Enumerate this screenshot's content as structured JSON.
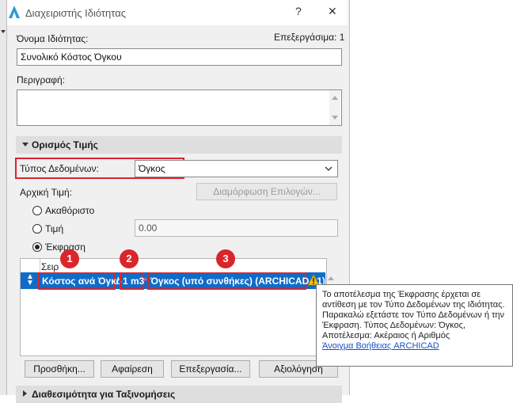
{
  "window": {
    "title": "Διαχειριστής Ιδιότητας",
    "help_glyph": "?",
    "close_glyph": "✕"
  },
  "header": {
    "name_label": "Όνομα Ιδιότητας:",
    "edit_count": "Επεξεργάσιμα: 1",
    "name_value": "Συνολικό Κόστος Όγκου",
    "description_label": "Περιγραφή:"
  },
  "value_definition": {
    "section_title": "Ορισμός Τιμής",
    "data_type_label": "Τύπος Δεδομένων:",
    "data_type_value": "Όγκος",
    "initial_value_label": "Αρχική Τιμή:",
    "options_button": "Διαμόρφωση Επιλογών...",
    "radio_undefined": "Ακαθόριστο",
    "radio_value": "Τιμή",
    "value_field": "0.00",
    "radio_expression": "Έκφραση",
    "column_header": "Σειρ",
    "expression": {
      "part1": "Κόστος ανά Όγκο",
      "op1": "/",
      "part2": "1 m3",
      "op2": "*",
      "part3": "Όγκος (υπό συνθήκες) (ARCHICAD 21)"
    },
    "badges": [
      "1",
      "2",
      "3"
    ],
    "warning_glyph": "⚠"
  },
  "buttons": {
    "add": "Προσθήκη...",
    "remove": "Αφαίρεση",
    "edit": "Επεξεργασία...",
    "evaluate": "Αξιολόγηση"
  },
  "bottom_section": "Διαθεσιμότητα για Ταξινομήσεις",
  "tooltip": {
    "text": "Το αποτέλεσμα της Έκφρασης έρχεται σε αντίθεση με τον Τύπο Δεδομένων της Ιδιότητας. Παρακαλώ εξετάστε τον Τύπο Δεδομένων ή την Έκφραση. Τύπος Δεδομένων: Όγκος, Αποτέλεσμα: Ακέραιος ή Αριθμός",
    "link": "Άνοιγμα Βοήθειας ARCHICAD"
  },
  "colors": {
    "selection": "#0f6cc9",
    "highlight_red": "#d9262b",
    "warning_yellow": "#f2c10f"
  }
}
